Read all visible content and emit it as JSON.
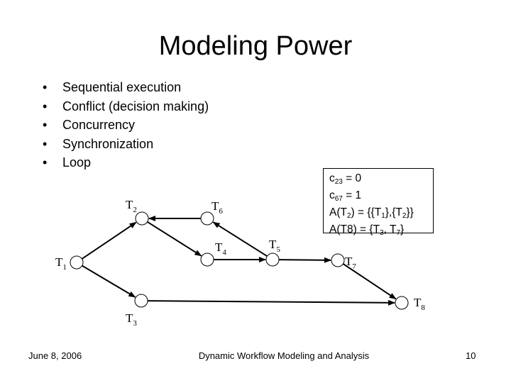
{
  "slide": {
    "title": "Modeling Power",
    "bullet_glyph": "•",
    "bullets": [
      "Sequential execution",
      "Conflict (decision making)",
      "Concurrency",
      "Synchronization",
      "Loop"
    ]
  },
  "diagram": {
    "nodes": [
      {
        "id": "T1",
        "base": "T",
        "sub": "1"
      },
      {
        "id": "T2",
        "base": "T",
        "sub": "2"
      },
      {
        "id": "T3",
        "base": "T",
        "sub": "3"
      },
      {
        "id": "T4",
        "base": "T",
        "sub": "4"
      },
      {
        "id": "T5",
        "base": "T",
        "sub": "5"
      },
      {
        "id": "T6",
        "base": "T",
        "sub": "6"
      },
      {
        "id": "T7",
        "base": "T",
        "sub": "7"
      },
      {
        "id": "T8",
        "base": "T",
        "sub": "8"
      }
    ],
    "edges": [
      {
        "from": "T1",
        "to": "T2"
      },
      {
        "from": "T1",
        "to": "T3"
      },
      {
        "from": "T2",
        "to": "T4"
      },
      {
        "from": "T4",
        "to": "T5"
      },
      {
        "from": "T5",
        "to": "T6"
      },
      {
        "from": "T6",
        "to": "T2"
      },
      {
        "from": "T5",
        "to": "T7"
      },
      {
        "from": "T7",
        "to": "T8"
      },
      {
        "from": "T3",
        "to": "T8"
      }
    ]
  },
  "infobox": {
    "line1": {
      "pre": "c",
      "sub": "23",
      "post": " = 0"
    },
    "line2": {
      "pre": "c",
      "sub": "67",
      "post": " = 1"
    },
    "line3": {
      "a": "A(T",
      "a_sub": "2",
      "b": ") = {{T",
      "b_sub": "1",
      "c": "},{T",
      "c_sub": "2",
      "d": "}}"
    },
    "line4": {
      "a": "A(T8) = {T",
      "a_sub": "3",
      "b": ", T",
      "b_sub": "7",
      "c": "}"
    }
  },
  "footer": {
    "date": "June 8, 2006",
    "center": "Dynamic Workflow Modeling and Analysis",
    "page": "10"
  }
}
